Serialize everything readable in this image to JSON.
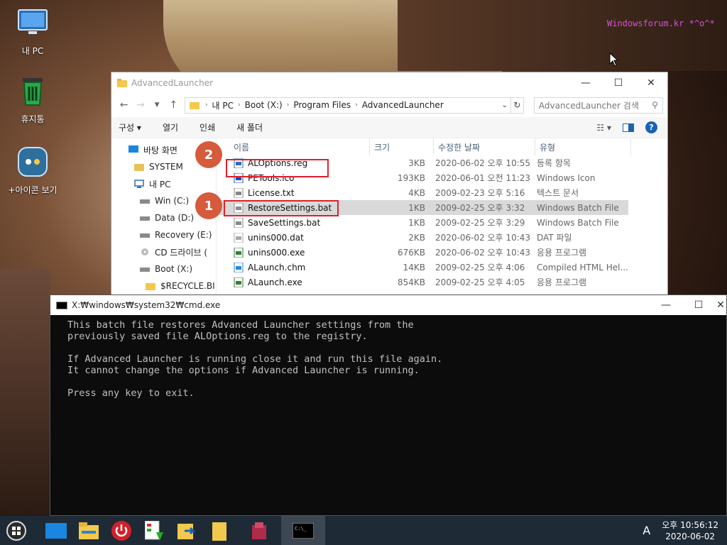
{
  "watermark": "Windowsforum.kr  *^o^*",
  "desktop": {
    "icons": [
      {
        "label": "내 PC"
      },
      {
        "label": "휴지통"
      },
      {
        "label": "+아이콘 보기"
      }
    ]
  },
  "explorer": {
    "title": "AdvancedLauncher",
    "address": [
      "내 PC",
      "Boot (X:)",
      "Program Files",
      "AdvancedLauncher"
    ],
    "search_placeholder": "AdvancedLauncher 검색",
    "commands": {
      "organize": "구성",
      "open": "열기",
      "print": "인쇄",
      "new_folder": "새 폴더"
    },
    "nav": [
      {
        "label": "바탕 화면"
      },
      {
        "label": "SYSTEM"
      },
      {
        "label": "내 PC"
      },
      {
        "label": "Win (C:)"
      },
      {
        "label": "Data (D:)"
      },
      {
        "label": "Recovery (E:)"
      },
      {
        "label": "CD 드라이브 ("
      },
      {
        "label": "Boot (X:)"
      },
      {
        "label": "$RECYCLE.BI"
      }
    ],
    "columns": {
      "name": "이름",
      "size": "크기",
      "date": "수정한 날짜",
      "type": "유형"
    },
    "files": [
      {
        "name": "ALOptions.reg",
        "size": "3KB",
        "date": "2020-06-02 오후 10:55",
        "type": "등록 항목",
        "icon": "reg-file-icon"
      },
      {
        "name": "PETools.ico",
        "size": "193KB",
        "date": "2020-06-01 오전 11:23",
        "type": "Windows Icon",
        "icon": "ico-file-icon"
      },
      {
        "name": "License.txt",
        "size": "4KB",
        "date": "2009-02-23 오후 5:16",
        "type": "텍스트 문서",
        "icon": "text-file-icon"
      },
      {
        "name": "RestoreSettings.bat",
        "size": "1KB",
        "date": "2009-02-25 오후 3:32",
        "type": "Windows Batch File",
        "icon": "bat-file-icon"
      },
      {
        "name": "SaveSettings.bat",
        "size": "1KB",
        "date": "2009-02-25 오후 3:29",
        "type": "Windows Batch File",
        "icon": "bat-file-icon"
      },
      {
        "name": "unins000.dat",
        "size": "2KB",
        "date": "2020-06-02 오후 10:43",
        "type": "DAT 파일",
        "icon": "dat-file-icon"
      },
      {
        "name": "unins000.exe",
        "size": "676KB",
        "date": "2020-06-02 오후 10:43",
        "type": "응용 프로그램",
        "icon": "exe-file-icon"
      },
      {
        "name": "ALaunch.chm",
        "size": "14KB",
        "date": "2009-02-25 오후 4:06",
        "type": "Compiled HTML Hel...",
        "icon": "chm-file-icon"
      },
      {
        "name": "ALaunch.exe",
        "size": "854KB",
        "date": "2009-02-25 오후 4:05",
        "type": "응용 프로그램",
        "icon": "exe-file-icon"
      }
    ],
    "badges": {
      "first": "1",
      "second": "2"
    }
  },
  "cmd": {
    "title": "X:₩windows₩system32₩cmd.exe",
    "output": "This batch file restores Advanced Launcher settings from the\npreviously saved file ALOptions.reg to the registry.\n\nIf Advanced Launcher is running close it and run this file again.\nIt cannot change the options if Advanced Launcher is running.\n\nPress any key to exit."
  },
  "taskbar": {
    "ime": "A",
    "time": "오후 10:56:12",
    "date": "2020-06-02"
  },
  "colors": {
    "highlight_box": "#e0202a",
    "badge": "#d65a3c",
    "taskbar": "#1e2a36"
  }
}
